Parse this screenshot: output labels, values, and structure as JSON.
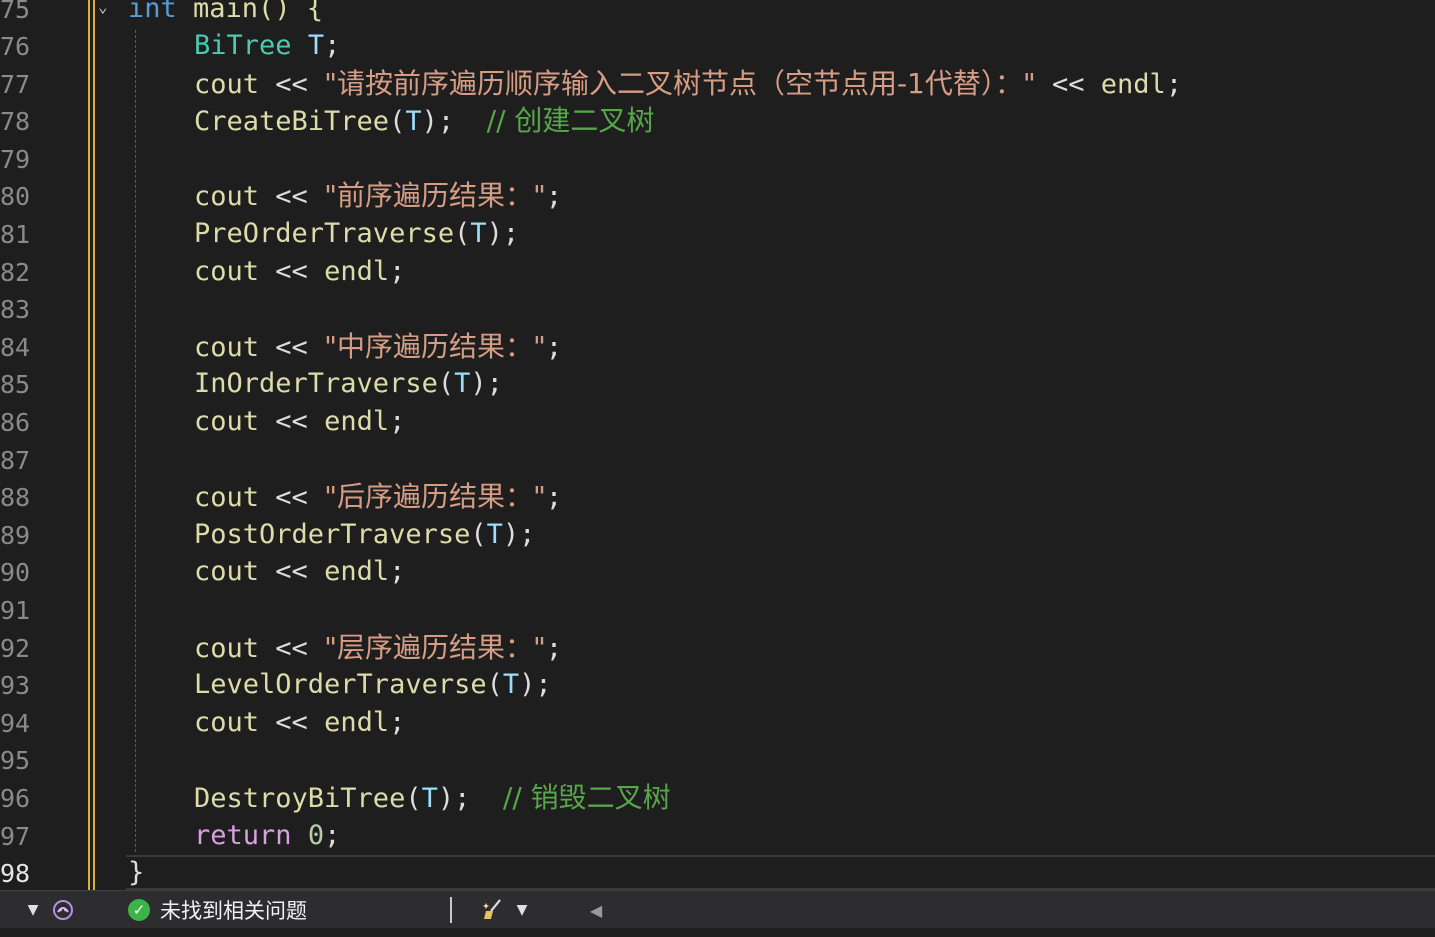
{
  "editor": {
    "line_numbers": [
      "75",
      "76",
      "77",
      "78",
      "79",
      "80",
      "81",
      "82",
      "83",
      "84",
      "85",
      "86",
      "87",
      "88",
      "89",
      "90",
      "91",
      "92",
      "93",
      "94",
      "95",
      "96",
      "97",
      "98"
    ],
    "current_line": "98",
    "lines": {
      "l75": {
        "kw": "int",
        "rest": " main() {"
      },
      "l76": {
        "type": "BiTree",
        "var": "T",
        "end": ";"
      },
      "l77": {
        "id": "cout",
        "op": " << ",
        "str": "\"请按前序遍历顺序输入二叉树节点（空节点用-1代替）：\"",
        "op2": " << ",
        "id2": "endl",
        "end": ";"
      },
      "l78": {
        "fn": "CreateBiTree",
        "open": "(",
        "var": "T",
        "close": ");",
        "comment": "// 创建二叉树"
      },
      "l80": {
        "id": "cout",
        "op": " << ",
        "str": "\"前序遍历结果：\"",
        "end": ";"
      },
      "l81": {
        "fn": "PreOrderTraverse",
        "open": "(",
        "var": "T",
        "close": ");"
      },
      "l82": {
        "id": "cout",
        "op": " << ",
        "id2": "endl",
        "end": ";"
      },
      "l84": {
        "id": "cout",
        "op": " << ",
        "str": "\"中序遍历结果：\"",
        "end": ";"
      },
      "l85": {
        "fn": "InOrderTraverse",
        "open": "(",
        "var": "T",
        "close": ");"
      },
      "l86": {
        "id": "cout",
        "op": " << ",
        "id2": "endl",
        "end": ";"
      },
      "l88": {
        "id": "cout",
        "op": " << ",
        "str": "\"后序遍历结果：\"",
        "end": ";"
      },
      "l89": {
        "fn": "PostOrderTraverse",
        "open": "(",
        "var": "T",
        "close": ");"
      },
      "l90": {
        "id": "cout",
        "op": " << ",
        "id2": "endl",
        "end": ";"
      },
      "l92": {
        "id": "cout",
        "op": " << ",
        "str": "\"层序遍历结果：\"",
        "end": ";"
      },
      "l93": {
        "fn": "LevelOrderTraverse",
        "open": "(",
        "var": "T",
        "close": ");"
      },
      "l94": {
        "id": "cout",
        "op": " << ",
        "id2": "endl",
        "end": ";"
      },
      "l96": {
        "fn": "DestroyBiTree",
        "open": "(",
        "var": "T",
        "close": ");",
        "comment": "// 销毁二叉树"
      },
      "l97": {
        "kw": "return",
        "num": "0",
        "end": ";"
      },
      "l98": {
        "brace": "}"
      }
    }
  },
  "statusbar": {
    "issues_text": "未找到相关问题",
    "icons": {
      "zoom_dropdown": "caret-down-icon",
      "copilot": "copilot-icon",
      "issues_check": "check-circle-icon",
      "cleanup": "brush-icon",
      "cleanup_dropdown": "caret-down-icon",
      "scroll_left": "caret-left-icon"
    }
  },
  "colors": {
    "background": "#1e1e1e",
    "keyword": "#569cd6",
    "control_keyword": "#d8a0df",
    "type": "#4ec9b0",
    "function": "#dcdcaa",
    "variable": "#9cdcfe",
    "string": "#d69d85",
    "comment": "#57a64a",
    "number": "#b5cea8",
    "change_bar": "#d8b13a",
    "status_ok": "#3bb44a"
  }
}
